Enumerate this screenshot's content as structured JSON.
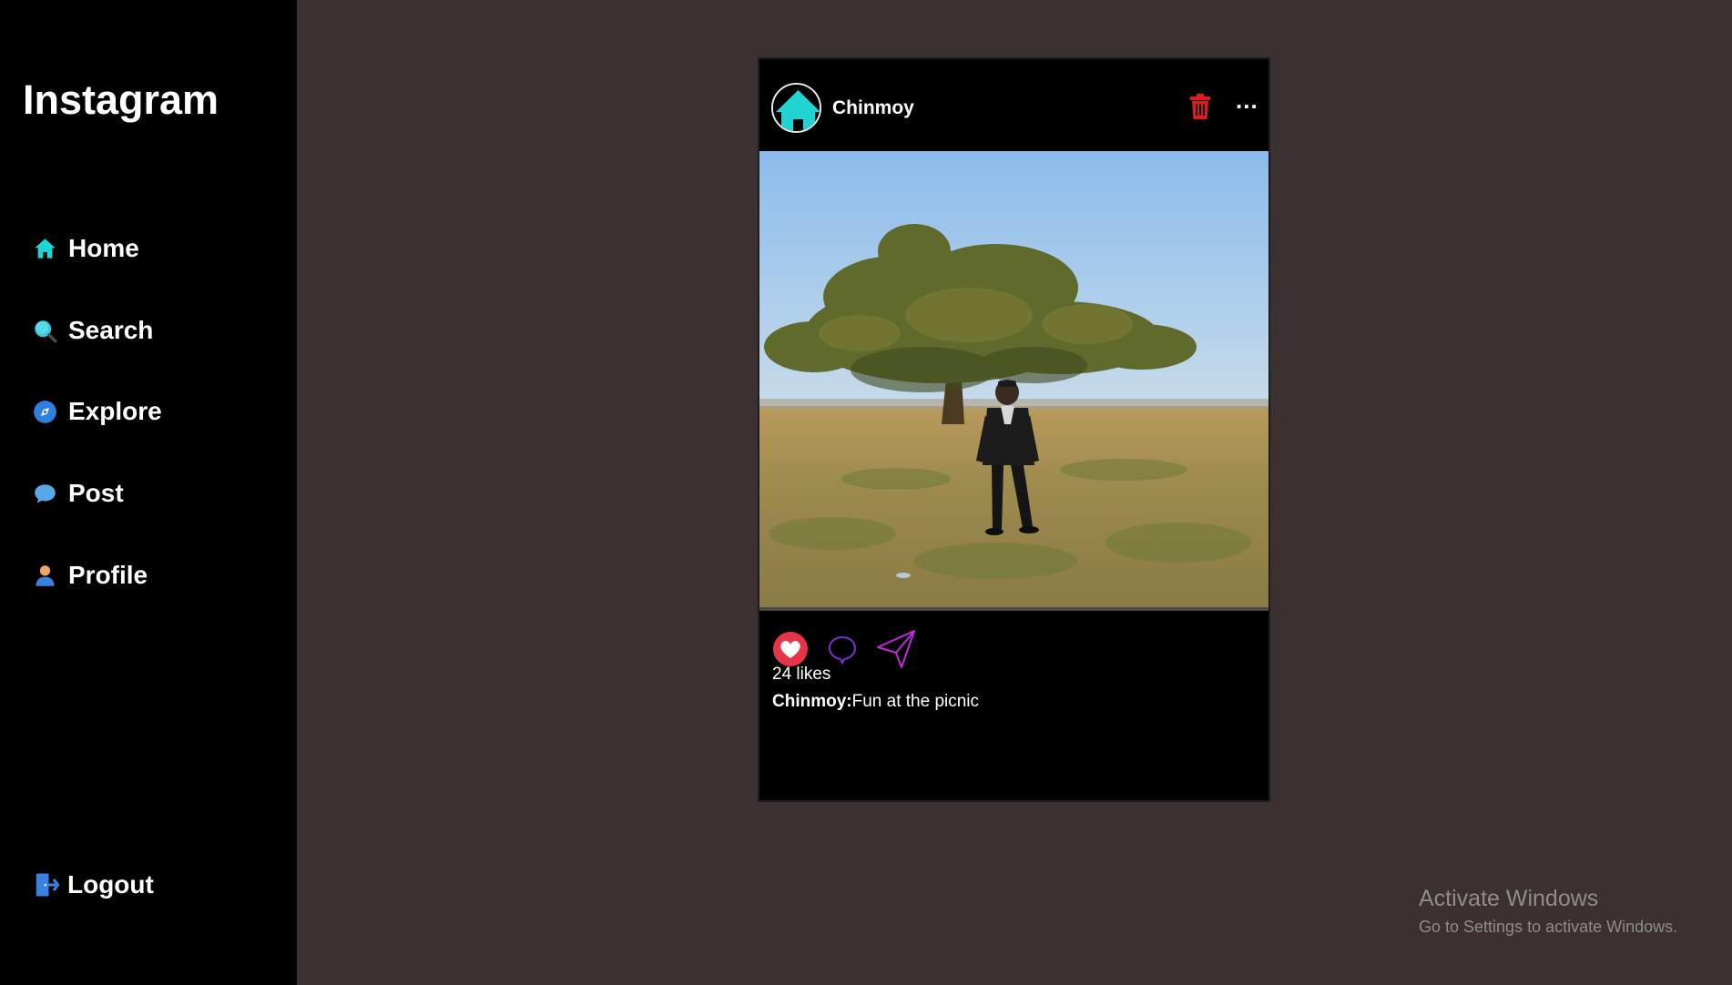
{
  "sidebar": {
    "brand": "Instagram",
    "items": [
      {
        "label": "Home",
        "icon": "home-icon"
      },
      {
        "label": "Search",
        "icon": "search-icon"
      },
      {
        "label": "Explore",
        "icon": "compass-icon"
      },
      {
        "label": "Post",
        "icon": "chat-bubble-icon"
      },
      {
        "label": "Profile",
        "icon": "user-icon"
      }
    ],
    "logout": {
      "label": "Logout",
      "icon": "logout-icon"
    }
  },
  "post": {
    "username": "Chinmoy",
    "avatar_icon": "home-icon",
    "delete_icon": "trash-icon",
    "more_label": "...",
    "photo_description_icon": "photo",
    "likes": "24 likes",
    "caption_user": "Chinmoy:",
    "caption_text": "Fun at the picnic"
  },
  "colors": {
    "page_bg": "#3a3130",
    "sidebar_bg": "#000000",
    "accent_cyan": "#22d3d3",
    "delete_red": "#e01b1b",
    "like_red": "#e8344a",
    "comment_purple": "#7b2fd1",
    "share_magenta": "#c02bd8"
  },
  "watermark": {
    "title": "Activate Windows",
    "subtitle": "Go to Settings to activate Windows."
  }
}
